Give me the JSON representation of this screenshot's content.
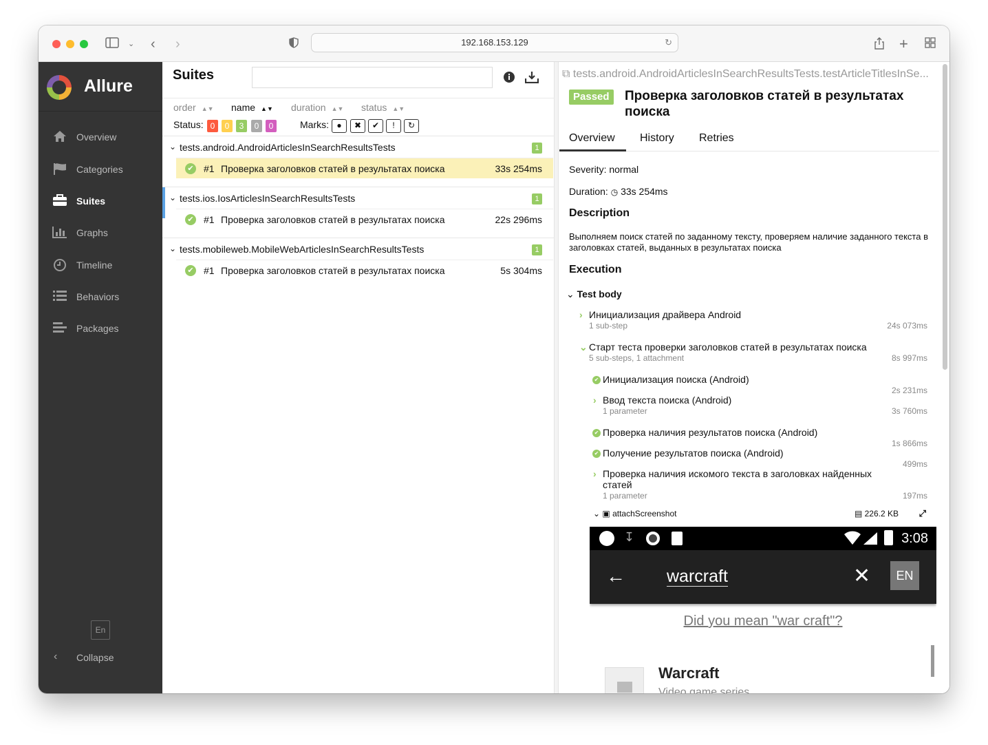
{
  "browser": {
    "url": "192.168.153.129"
  },
  "sidebar": {
    "brand": "Allure",
    "items": [
      {
        "label": "Overview",
        "icon": "home-icon"
      },
      {
        "label": "Categories",
        "icon": "flag-icon"
      },
      {
        "label": "Suites",
        "icon": "briefcase-icon"
      },
      {
        "label": "Graphs",
        "icon": "bar-chart-icon"
      },
      {
        "label": "Timeline",
        "icon": "clock-icon"
      },
      {
        "label": "Behaviors",
        "icon": "list-icon"
      },
      {
        "label": "Packages",
        "icon": "align-left-icon"
      }
    ],
    "active": "Suites",
    "language": "En",
    "collapse": "Collapse"
  },
  "suites": {
    "title": "Suites",
    "sorters": {
      "order": "order",
      "name": "name",
      "duration": "duration",
      "status": "status"
    },
    "status_label": "Status:",
    "status_counts": [
      {
        "value": "0",
        "color": "#fd5a3e"
      },
      {
        "value": "0",
        "color": "#ffd050"
      },
      {
        "value": "3",
        "color": "#97cc64"
      },
      {
        "value": "0",
        "color": "#aaaaaa"
      },
      {
        "value": "0",
        "color": "#d35ebe"
      }
    ],
    "marks_label": "Marks:",
    "groups": [
      {
        "name": "tests.android.AndroidArticlesInSearchResultsTests",
        "count": "1",
        "cases": [
          {
            "num": "#1",
            "title": "Проверка заголовков статей в результатах поиска",
            "duration": "33s 254ms"
          }
        ]
      },
      {
        "name": "tests.ios.IosArticlesInSearchResultsTests",
        "count": "1",
        "cases": [
          {
            "num": "#1",
            "title": "Проверка заголовков статей в результатах поиска",
            "duration": "22s 296ms"
          }
        ]
      },
      {
        "name": "tests.mobileweb.MobileWebArticlesInSearchResultsTests",
        "count": "1",
        "cases": [
          {
            "num": "#1",
            "title": "Проверка заголовков статей в результатах поиска",
            "duration": "5s 304ms"
          }
        ]
      }
    ]
  },
  "detail": {
    "fullname": "tests.android.AndroidArticlesInSearchResultsTests.testArticleTitlesInSe...",
    "status": "Passed",
    "title": "Проверка заголовков статей в результатах поиска",
    "tabs": [
      "Overview",
      "History",
      "Retries"
    ],
    "severity": "Severity: normal",
    "duration_label": "Duration:",
    "duration": "33s 254ms",
    "description_heading": "Description",
    "description": "Выполняем поиск статей по заданному тексту, проверяем наличие заданного текста в заголовках статей, выданных в результатах поиска",
    "execution_heading": "Execution",
    "test_body": "Test body",
    "steps": [
      {
        "title": "Инициализация драйвера Android",
        "sub": "1 sub-step",
        "duration": "24s 073ms"
      },
      {
        "title": "Старт теста проверки заголовков статей в результатах поиска",
        "sub": "5 sub-steps, 1 attachment",
        "duration": "8s 997ms"
      },
      {
        "title": "Инициализация поиска (Android)",
        "sub": "",
        "duration": "2s 231ms"
      },
      {
        "title": "Ввод текста поиска (Android)",
        "sub": "1 parameter",
        "duration": "3s 760ms"
      },
      {
        "title": "Проверка наличия результатов поиска (Android)",
        "sub": "",
        "duration": "1s 866ms"
      },
      {
        "title": "Получение результатов поиска (Android)",
        "sub": "",
        "duration": "499ms"
      },
      {
        "title": "Проверка наличия искомого текста в заголовках найденных статей",
        "sub": "1 parameter",
        "duration": "197ms"
      }
    ],
    "attachment": {
      "name": "attachScreenshot",
      "size": "226.2 KB"
    },
    "screenshot": {
      "time": "3:08",
      "query": "warcraft",
      "lang": "EN",
      "did_you_mean": "Did you mean \"war craft\"?",
      "result_title": "Warcraft",
      "result_sub": "Video game series"
    }
  }
}
